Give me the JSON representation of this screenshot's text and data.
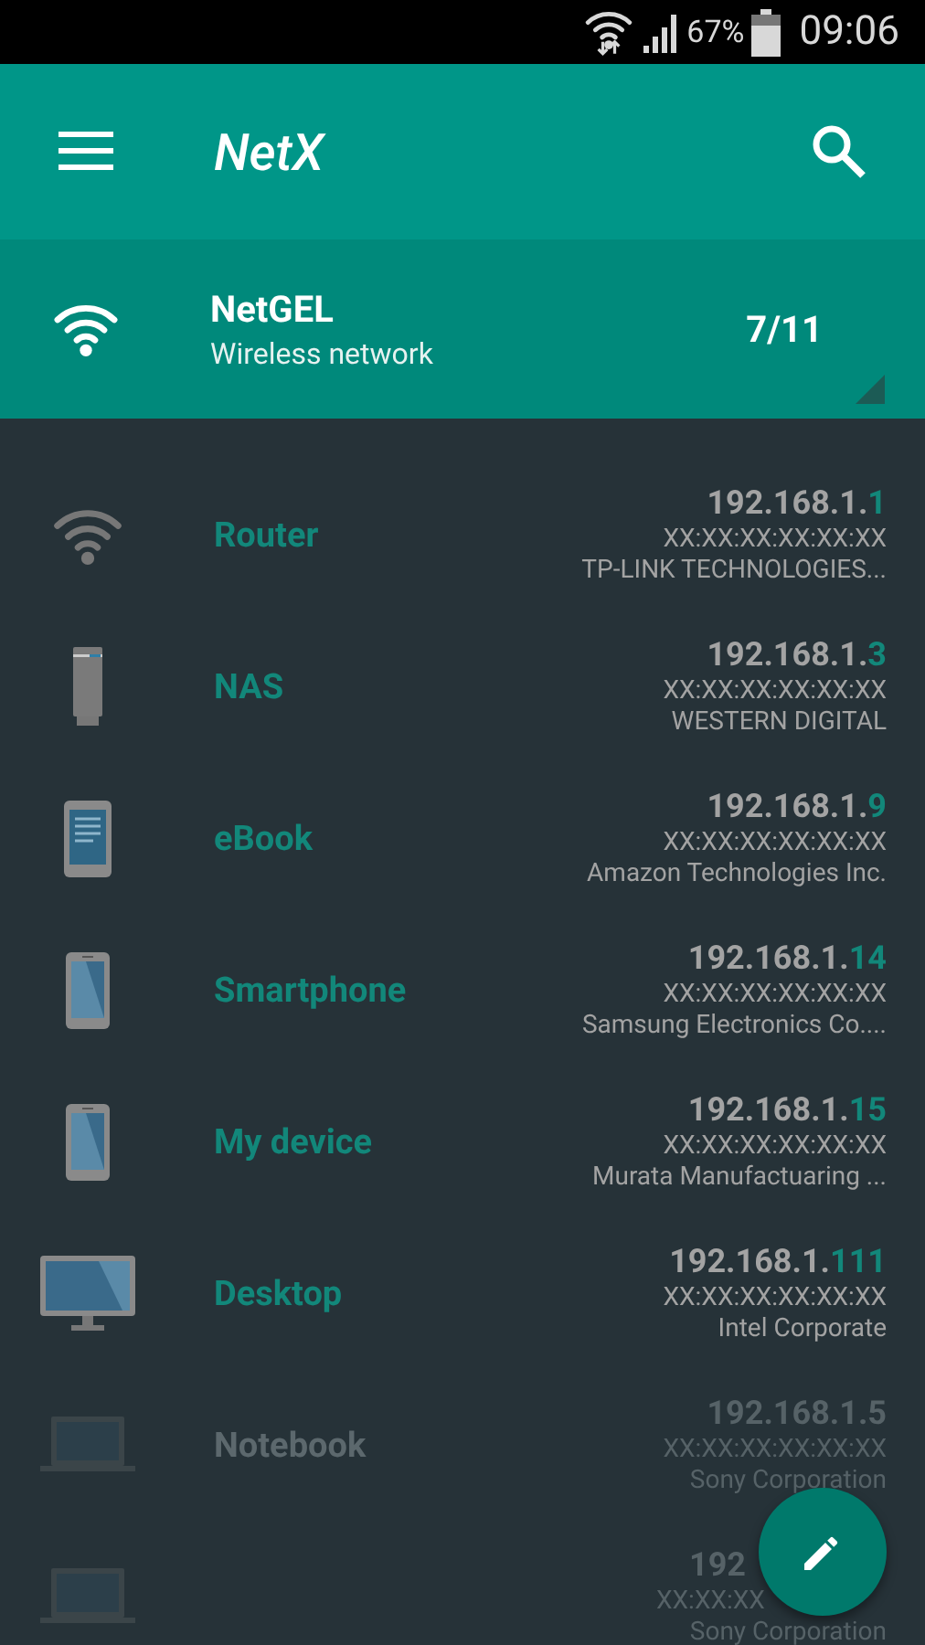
{
  "status_bar": {
    "battery": "67%",
    "time": "09:06"
  },
  "app_bar": {
    "title": "NetX"
  },
  "network": {
    "name": "NetGEL",
    "type": "Wireless network",
    "count": "7/11"
  },
  "devices": [
    {
      "kind": "router",
      "name": "Router",
      "online": true,
      "ip_base": "192.168.1.",
      "ip_host": "1",
      "mac": "XX:XX:XX:XX:XX:XX",
      "vendor": "TP-LINK TECHNOLOGIES..."
    },
    {
      "kind": "nas",
      "name": "NAS",
      "online": true,
      "ip_base": "192.168.1.",
      "ip_host": "3",
      "mac": "XX:XX:XX:XX:XX:XX",
      "vendor": "WESTERN DIGITAL"
    },
    {
      "kind": "ebook",
      "name": "eBook",
      "online": true,
      "ip_base": "192.168.1.",
      "ip_host": "9",
      "mac": "XX:XX:XX:XX:XX:XX",
      "vendor": "Amazon Technologies Inc."
    },
    {
      "kind": "phone",
      "name": "Smartphone",
      "online": true,
      "ip_base": "192.168.1.",
      "ip_host": "14",
      "mac": "XX:XX:XX:XX:XX:XX",
      "vendor": "Samsung Electronics Co...."
    },
    {
      "kind": "phone",
      "name": "My device",
      "online": true,
      "ip_base": "192.168.1.",
      "ip_host": "15",
      "mac": "XX:XX:XX:XX:XX:XX",
      "vendor": "Murata Manufactuaring ..."
    },
    {
      "kind": "desktop",
      "name": "Desktop",
      "online": true,
      "ip_base": "192.168.1.",
      "ip_host": "111",
      "mac": "XX:XX:XX:XX:XX:XX",
      "vendor": "Intel Corporate"
    },
    {
      "kind": "laptop",
      "name": "Notebook",
      "online": false,
      "ip_base": "192.168.1.",
      "ip_host": "5",
      "mac": "XX:XX:XX:XX:XX:XX",
      "vendor": "Sony Corporation"
    },
    {
      "kind": "laptop",
      "online": false,
      "ip_base": "192",
      "mac": "XX:XX:XX",
      "vendor": "Sony Corporation"
    }
  ]
}
